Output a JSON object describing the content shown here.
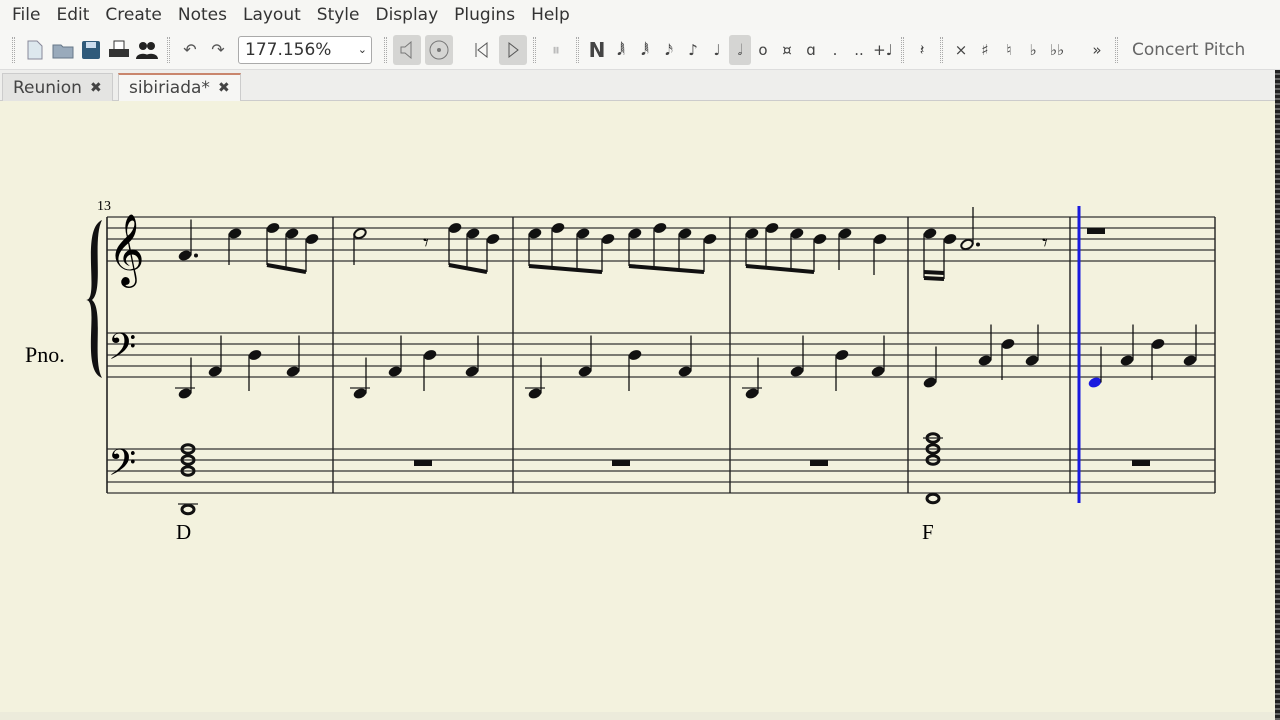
{
  "menubar": {
    "items": [
      "File",
      "Edit",
      "Create",
      "Notes",
      "Layout",
      "Style",
      "Display",
      "Plugins",
      "Help"
    ]
  },
  "toolbar": {
    "zoom_value": "177.156%",
    "concert_pitch_label": "Concert Pitch",
    "note_input_label": "N",
    "icons": [
      "new-file",
      "open-file",
      "save",
      "print",
      "collaborate",
      "undo",
      "redo",
      "mute",
      "metronome",
      "rewind",
      "play",
      "loop",
      "64th",
      "32nd",
      "16th",
      "eighth",
      "quarter",
      "half",
      "whole",
      "breve",
      "longa",
      "dot",
      "double-dot",
      "tie",
      "rest",
      "double-sharp",
      "sharp",
      "natural",
      "flat",
      "double-flat",
      "more"
    ],
    "more_label": "»"
  },
  "tabs": [
    {
      "label": "Reunion",
      "active": false
    },
    {
      "label": "sibiriada*",
      "active": true
    }
  ],
  "score": {
    "measure_number": "13",
    "instrument_label": "Pno.",
    "chord_symbols": [
      "D",
      "F"
    ],
    "cursor_color": "#1a1adf",
    "selected_note_color": "#1a1adf"
  }
}
